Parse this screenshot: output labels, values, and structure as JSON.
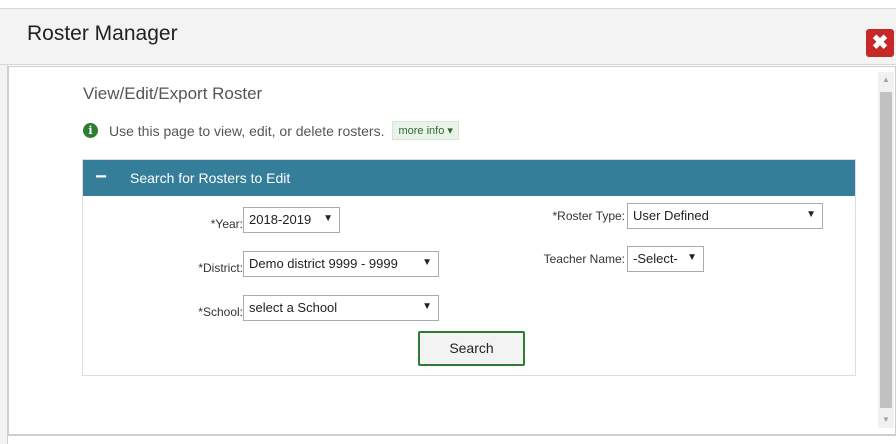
{
  "dialog": {
    "title": "Roster Manager",
    "close_symbol": "✖"
  },
  "page": {
    "heading": "View/Edit/Export Roster",
    "info_text": "Use this page to view, edit, or delete rosters.",
    "more_info": "more info ▾"
  },
  "panel": {
    "toggle_symbol": "−",
    "title": "Search for Rosters to Edit",
    "fields": {
      "year": {
        "label": "*Year:",
        "value": "2018-2019"
      },
      "district": {
        "label": "*District:",
        "value": "Demo district 9999 - 9999"
      },
      "school": {
        "label": "*School:",
        "value": "select a School"
      },
      "roster_type": {
        "label": "*Roster Type:",
        "value": "User Defined"
      },
      "teacher_name": {
        "label": "Teacher Name:",
        "value": "-Select-"
      }
    },
    "search_label": "Search"
  },
  "colors": {
    "header_blue": "#347e9a",
    "close_red": "#c62828",
    "accent_green": "#2e7d32"
  }
}
